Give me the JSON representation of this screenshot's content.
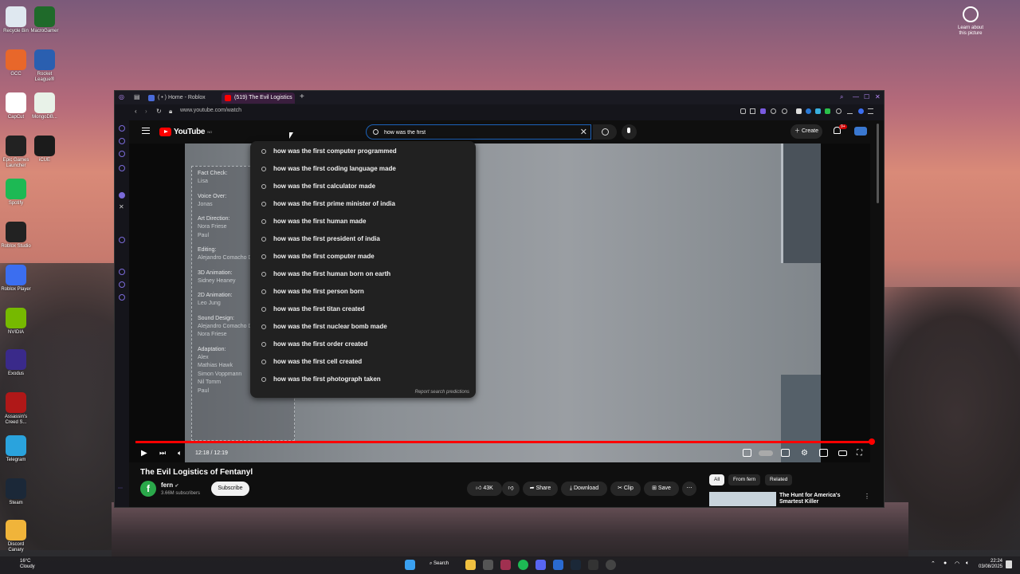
{
  "desktop": {
    "icons": [
      {
        "label": "Recycle Bin",
        "color": "#dfe8f0"
      },
      {
        "label": "MacroGamer",
        "color": "#1f6a2a"
      },
      {
        "label": "GCC",
        "color": "#e8672a"
      },
      {
        "label": "Rocket League®",
        "color": "#2a5fb0"
      },
      {
        "label": "CapCut",
        "color": "#ffffff"
      },
      {
        "label": "MongoDB...",
        "color": "#e8f2e8"
      },
      {
        "label": "Epic Games Launcher",
        "color": "#222222"
      },
      {
        "label": "iCUE",
        "color": "#1b1b1b"
      },
      {
        "label": "Spotify",
        "color": "#1db954"
      },
      {
        "label": "Roblox Studio",
        "color": "#222222"
      },
      {
        "label": "Roblox Player",
        "color": "#3b6ef0"
      },
      {
        "label": "NVIDIA",
        "color": "#76b900"
      },
      {
        "label": "Exodus",
        "color": "#3a2a8a"
      },
      {
        "label": "Assassin's Creed S...",
        "color": "#b01818"
      },
      {
        "label": "Telegram",
        "color": "#2aa3dd"
      },
      {
        "label": "Steam",
        "color": "#1b2838"
      },
      {
        "label": "Discord Canary",
        "color": "#f0b43a"
      }
    ],
    "learn_label": "Learn about this picture"
  },
  "browser": {
    "tabs": [
      {
        "label": "( • ) Home - Roblox",
        "active": false,
        "fav_color": "#4a6bd8"
      },
      {
        "label": "(519) The Evil Logistics of",
        "active": true,
        "fav_color": "#ff0000"
      }
    ],
    "new_tab": "+",
    "url": "www.youtube.com/watch"
  },
  "youtube": {
    "logo_text": "YouTube",
    "logo_country": "NO",
    "search_value": "how was the first",
    "create_label": "Create",
    "notif_badge": "9+",
    "suggestions": [
      "how was the first computer programmed",
      "how was the first coding language made",
      "how was the first calculator made",
      "how was the first prime minister of india",
      "how was the first human made",
      "how was the first president of india",
      "how was the first computer made",
      "how was the first human born on earth",
      "how was the first person born",
      "how was the first titan created",
      "how was the first nuclear bomb made",
      "how was the first order created",
      "how was the first cell created",
      "how was the first photograph taken"
    ],
    "report_label": "Report search predictions",
    "credits": [
      {
        "role": "Fact Check:",
        "names": [
          "Lisa"
        ]
      },
      {
        "role": "Voice Over:",
        "names": [
          "Jonas"
        ]
      },
      {
        "role": "Art Direction:",
        "names": [
          "Nora Friese",
          "Paul"
        ]
      },
      {
        "role": "Editing:",
        "names": [
          "Alejandro Comacho Diaz"
        ]
      },
      {
        "role": "3D Animation:",
        "names": [
          "Sidney Heaney"
        ]
      },
      {
        "role": "2D Animation:",
        "names": [
          "Leo Jung"
        ]
      },
      {
        "role": "Sound Design:",
        "names": [
          "Alejandro Comacho Diaz",
          "Nora Friese"
        ]
      },
      {
        "role": "Adaptation:",
        "names": [
          "Alex",
          "Mathias Hawk",
          "Simon Voppmann",
          "Nil Tomm",
          "Paul"
        ]
      }
    ],
    "progress": 0.9986,
    "time": "12:18 / 12:19",
    "video_title": "The Evil Logistics of Fentanyl",
    "channel": {
      "name": "fern",
      "avatar": "f",
      "subscribers": "3.66M subscribers"
    },
    "subscribe_label": "Subscribe",
    "actions": {
      "likes": "43K",
      "share": "Share",
      "download": "Download",
      "clip": "Clip",
      "save": "Save",
      "more": "⋯"
    },
    "chips": [
      "All",
      "From fern",
      "Related"
    ],
    "related_title": "The Hunt for America's Smartest Killer"
  },
  "taskbar": {
    "weather_temp": "16°C",
    "weather_desc": "Cloudy",
    "search_label": "Search",
    "time": "22:24",
    "date": "03/08/2025"
  }
}
